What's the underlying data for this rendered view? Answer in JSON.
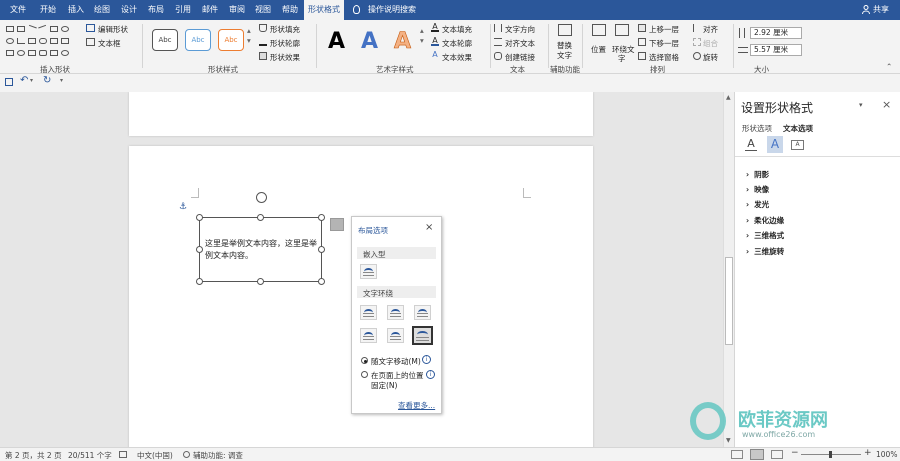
{
  "tabs": [
    "文件",
    "开始",
    "插入",
    "绘图",
    "设计",
    "布局",
    "引用",
    "邮件",
    "审阅",
    "视图",
    "帮助",
    "形状格式"
  ],
  "active_tab": "形状格式",
  "search": {
    "label": "操作说明搜索"
  },
  "share": {
    "label": "共享"
  },
  "ribbon": {
    "insert_shape": {
      "edit_shape": "编辑形状",
      "textbox": "文本框",
      "group": "插入形状"
    },
    "shape_styles": {
      "abc": "Abc",
      "fill": "形状填充",
      "outline": "形状轮廓",
      "effect": "形状效果",
      "group": "形状样式"
    },
    "art_styles": {
      "letter": "A",
      "text_fill": "文本填充",
      "text_outline": "文本轮廓",
      "text_effect": "文本效果",
      "group": "艺术字样式"
    },
    "text": {
      "direction": "文字方向",
      "align": "对齐文本",
      "link": "创建链接",
      "group": "文本"
    },
    "accessibility": {
      "alt_text_1": "替换",
      "alt_text_2": "文字",
      "group": "辅助功能"
    },
    "arrange": {
      "position": "位置",
      "wrap_1": "环绕文",
      "wrap_2": "字",
      "forward": "上移一层",
      "backward": "下移一层",
      "select_pane": "选择窗格",
      "align": "对齐",
      "group_btn": "组合",
      "rotate": "旋转",
      "group": "排列"
    },
    "size": {
      "height": "2.92 厘米",
      "width": "5.57 厘米",
      "group": "大小"
    }
  },
  "document": {
    "textbox_text_line1": "这里是举例文本内容，这里是举",
    "textbox_text_line2": "例文本内容。"
  },
  "layout_popup": {
    "title": "布局选项",
    "inline_label": "嵌入型",
    "wrap_label": "文字环绕",
    "move_with_text": "随文字移动(M)",
    "fix_position_1": "在页面上的位置",
    "fix_position_2": "固定(N)",
    "see_more": "查看更多..."
  },
  "pane": {
    "title": "设置形状格式",
    "tab_shape": "形状选项",
    "tab_text": "文本选项",
    "items": [
      "阴影",
      "映像",
      "发光",
      "柔化边缘",
      "三维格式",
      "三维旋转"
    ]
  },
  "status": {
    "page": "第 2 页，共 2 页",
    "words": "20/511 个字",
    "language": "中文(中国)",
    "accessibility": "辅助功能: 调查",
    "zoom": "100%"
  },
  "watermark": {
    "cn": "欧菲资源网",
    "url": "www.office26.com"
  },
  "colors": {
    "accent": "#2b579a",
    "art_blue": "#4472c4",
    "art_orange": "#f4b183"
  }
}
